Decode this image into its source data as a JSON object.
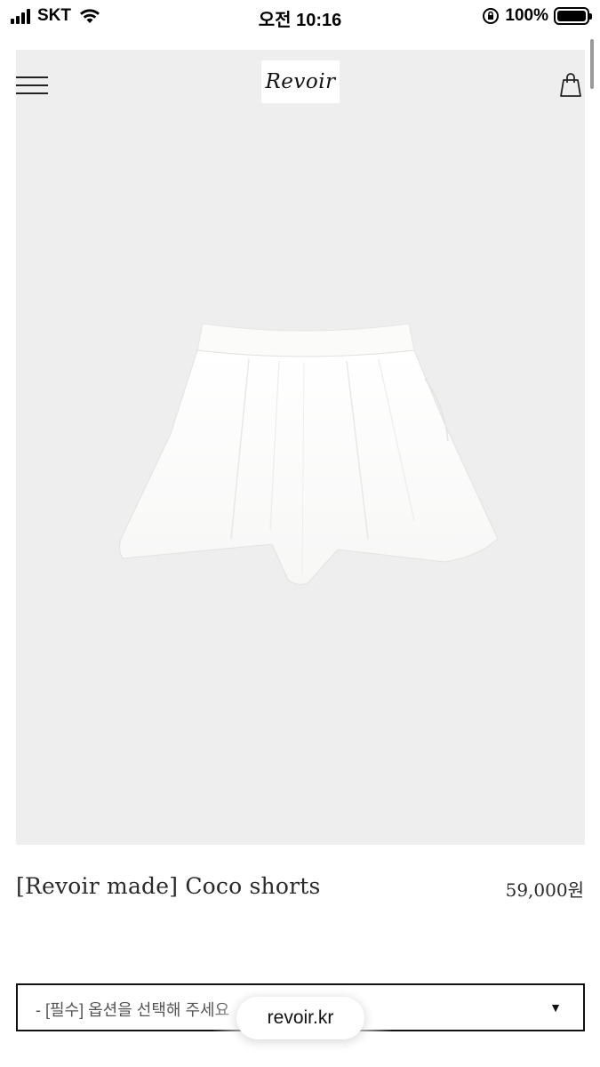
{
  "status_bar": {
    "carrier": "SKT",
    "time": "오전 10:16",
    "battery": "100%",
    "icons": [
      "signal-icon",
      "wifi-icon",
      "orientation-lock-icon",
      "battery-icon"
    ]
  },
  "header": {
    "logo": "Revoir",
    "menu_icon": "hamburger-menu-icon",
    "cart_icon": "shopping-bag-icon"
  },
  "product": {
    "name": "[Revoir made] Coco shorts",
    "price": "59,000원",
    "image": "white-pleated-shorts"
  },
  "option_select": {
    "placeholder": "- [필수] 옵션을 선택해 주세요",
    "arrow": "▼"
  },
  "browser": {
    "url": "revoir.kr"
  },
  "colors": {
    "hero_background": "#efeeef",
    "text": "#2a2a2a",
    "border": "#111111"
  }
}
